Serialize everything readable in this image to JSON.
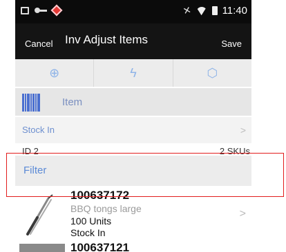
{
  "status_bar": {
    "time": "11:40",
    "icons": [
      "screen-icon",
      "key-icon",
      "app-alert-icon",
      "mute-icon",
      "wifi-icon",
      "battery-icon"
    ]
  },
  "header": {
    "cancel_label": "Cancel",
    "title": "Inv Adjust Items",
    "save_label": "Save"
  },
  "actions": [
    {
      "icon": "add-circle-icon",
      "glyph": "⊕"
    },
    {
      "icon": "lightning-icon",
      "glyph": "ϟ"
    },
    {
      "icon": "cube-icon",
      "glyph": "⬡"
    }
  ],
  "item_entry": {
    "icon": "barcode-icon",
    "label": "Item"
  },
  "reason": {
    "label": "Stock In"
  },
  "summary": {
    "id_text": "ID 2",
    "sku_count": "2 SKUs"
  },
  "filter": {
    "label": "Filter"
  },
  "products": [
    {
      "number": "100637172",
      "description": "BBQ tongs large",
      "units": "100 Units",
      "status": "Stock In",
      "image": "bbq-tongs-image"
    },
    {
      "number": "100637121",
      "image": "product-image"
    }
  ],
  "colors": {
    "accent": "#5b8ad6",
    "highlight_box": "#e21b1b",
    "header_bg": "#141414"
  }
}
